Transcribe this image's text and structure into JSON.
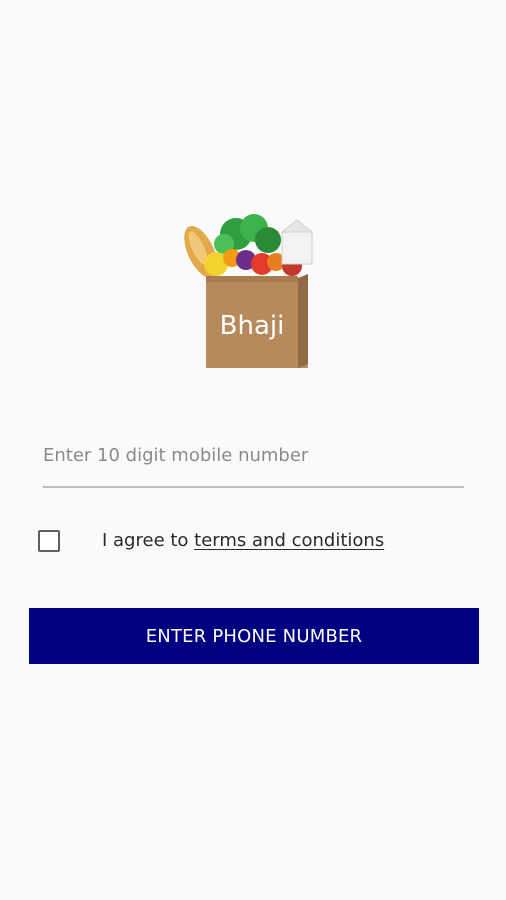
{
  "logo": {
    "text": "Bhaji",
    "colors": {
      "bag": "#b68a5c",
      "bag_side": "#8f6a42",
      "bread": "#e0a94a",
      "greens": "#2e9e3f",
      "tomato": "#e23b2b",
      "orange": "#f39c12",
      "purple": "#6b2d8a"
    }
  },
  "phone_field": {
    "value": "",
    "placeholder": "Enter 10 digit mobile number"
  },
  "agreement": {
    "checked": false,
    "prefix": "I agree to ",
    "link_text": "terms and conditions"
  },
  "primary_button": {
    "label": "ENTER PHONE NUMBER",
    "color": "#000080"
  }
}
